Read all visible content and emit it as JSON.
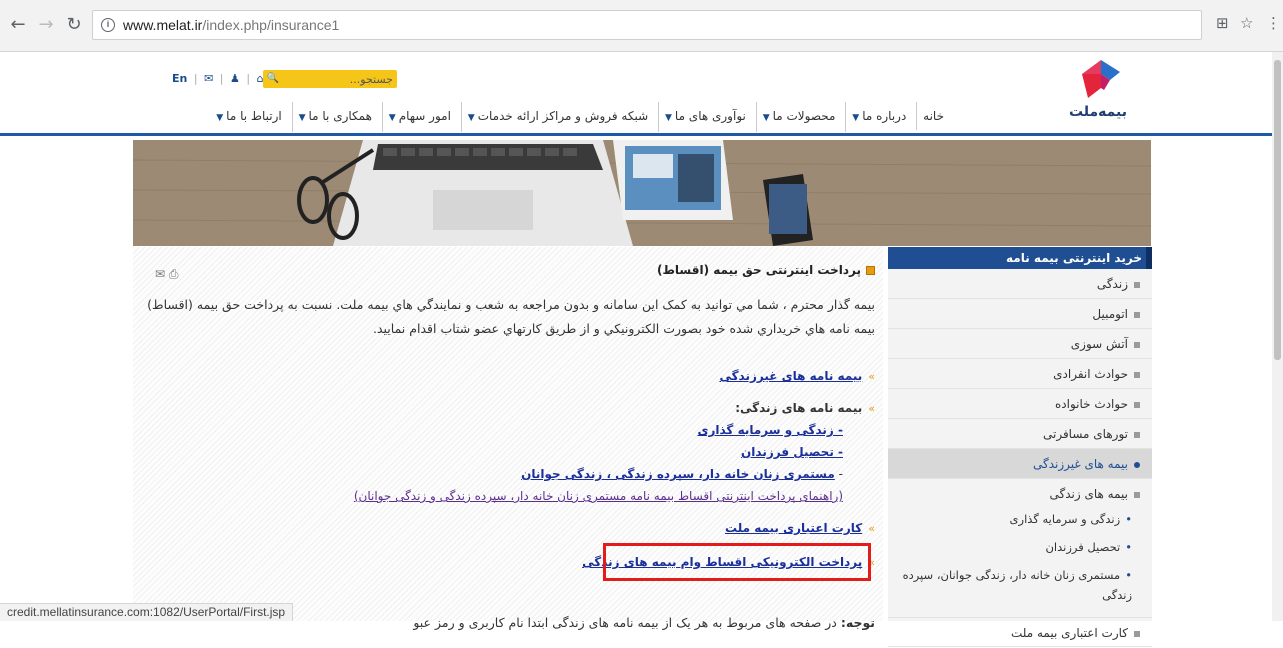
{
  "browser": {
    "url_host": "www.melat.ir",
    "url_path": "/index.php/insurance1",
    "status_url": "credit.mellatinsurance.com:1082/UserPortal/First.jsp"
  },
  "header": {
    "logo_text": "بیمه‌ملت",
    "lang": "En",
    "search_placeholder": "جستجو...",
    "nav": [
      "خانه",
      "درباره ما",
      "محصولات ما",
      "نوآوری های ما",
      "شبکه فروش و مراکز ارائه خدمات",
      "امور سهام",
      "همکاری با ما",
      "ارتباط با ما"
    ]
  },
  "sidebar": {
    "title": "خرید اینترنتی بیمه نامه",
    "items": [
      "زندگی",
      "اتومبیل",
      "آتش سوزی",
      "حوادث انفرادی",
      "حوادث خانواده",
      "تورهای مسافرتی"
    ],
    "active_item": "بیمه های غیرزندگی",
    "group_item": "بیمه های زندگی",
    "sub_items": [
      "زندگی و سرمایه گذاری",
      "تحصیل فرزندان",
      "مستمری زنان خانه دار، زندگی جوانان، سپرده زندگی"
    ],
    "last_item": "کارت اعتباری بیمه ملت"
  },
  "content": {
    "title": "پرداخت اینترنتی حق بیمه (اقساط)",
    "intro_line1": "بیمه گذار محترم ، شما مي توانيد به كمک اين سامانه و بدون مراجعه به شعب و نمايندگي هاي بيمه ملت. نسبت به پرداخت حق بيمه (اقساط)",
    "intro_line2": "بيمه نامه هاي خريداري شده خود بصورت الكترونيكي و از طريق كارتهاي عضو شتاب اقدام نماييد.",
    "link_non_life": "بیمه نامه های غیرزندگی",
    "life_heading": "بیمه نامه های زندگی:",
    "life_link1": "- زندگی و سرمایه گذاری",
    "life_link2": "- تحصیل فرزندان",
    "life_link3_prefix": "-",
    "life_link3": "مستمری زنان خانه دار، سپرده زندگی ، زندگی جوانان",
    "guide": "(راهنمای پرداخت اینترنتی اقساط بیمه نامه مستمری زنان خانه دار، سپرده زندگی و زندگی جوانان)",
    "link_credit": "کارت اعتباری بیمه ملت",
    "link_loan": "پرداخت الکترونیکی اقساط وام بیمه های زندگی",
    "note_label": "توجه:",
    "note_text": "در صفحه های مربوط به هر یک از بیمه نامه های زندگی ابتدا نام کاربری و رمز عبو"
  },
  "colors": {
    "brand_blue": "#1f4e92",
    "search_yellow": "#f5c518",
    "highlight_red": "#e31b1b",
    "link_blue": "#1a2f9a"
  }
}
